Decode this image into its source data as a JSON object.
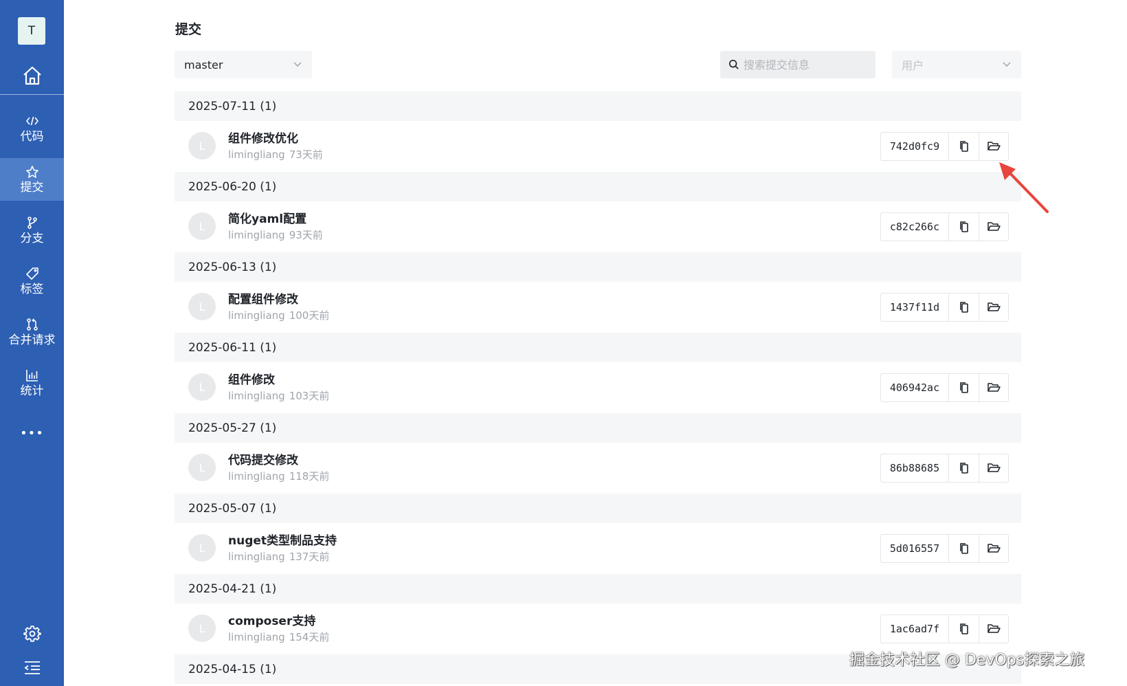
{
  "sidebar": {
    "avatar_letter": "T",
    "home_icon": "home-icon",
    "items": [
      {
        "label": "代码",
        "icon": "code-icon",
        "active": false
      },
      {
        "label": "提交",
        "icon": "pin-icon",
        "active": true
      },
      {
        "label": "分支",
        "icon": "branch-icon",
        "active": false
      },
      {
        "label": "标签",
        "icon": "tag-icon",
        "active": false
      },
      {
        "label": "合并请求",
        "icon": "merge-request-icon",
        "active": false
      },
      {
        "label": "统计",
        "icon": "chart-icon",
        "active": false
      }
    ],
    "more_label": "•••",
    "settings_icon": "gear-icon",
    "collapse_icon": "collapse-menu-icon"
  },
  "page": {
    "title": "提交"
  },
  "filters": {
    "branch_value": "master",
    "search_placeholder": "搜索提交信息",
    "user_placeholder": "用户"
  },
  "groups": [
    {
      "date": "2025-07-11 (1)",
      "commit": {
        "avatar": "L",
        "message": "组件修改优化",
        "author": "limingliang",
        "ago": "73天前",
        "hash": "742d0fc9"
      }
    },
    {
      "date": "2025-06-20 (1)",
      "commit": {
        "avatar": "L",
        "message": "简化yaml配置",
        "author": "limingliang",
        "ago": "93天前",
        "hash": "c82c266c"
      }
    },
    {
      "date": "2025-06-13 (1)",
      "commit": {
        "avatar": "L",
        "message": "配置组件修改",
        "author": "limingliang",
        "ago": "100天前",
        "hash": "1437f11d"
      }
    },
    {
      "date": "2025-06-11 (1)",
      "commit": {
        "avatar": "L",
        "message": "组件修改",
        "author": "limingliang",
        "ago": "103天前",
        "hash": "406942ac"
      }
    },
    {
      "date": "2025-05-27 (1)",
      "commit": {
        "avatar": "L",
        "message": "代码提交修改",
        "author": "limingliang",
        "ago": "118天前",
        "hash": "86b88685"
      }
    },
    {
      "date": "2025-05-07 (1)",
      "commit": {
        "avatar": "L",
        "message": "nuget类型制品支持",
        "author": "limingliang",
        "ago": "137天前",
        "hash": "5d016557"
      }
    },
    {
      "date": "2025-04-21 (1)",
      "commit": {
        "avatar": "L",
        "message": "composer支持",
        "author": "limingliang",
        "ago": "154天前",
        "hash": "1ac6ad7f"
      }
    },
    {
      "date": "2025-04-15 (1)"
    }
  ],
  "watermark": "掘金技术社区 @ DevOps探索之旅",
  "colors": {
    "sidebar_bg": "#2d5fb3",
    "sidebar_active": "#4f7ec9",
    "arrow": "#e8453c"
  }
}
